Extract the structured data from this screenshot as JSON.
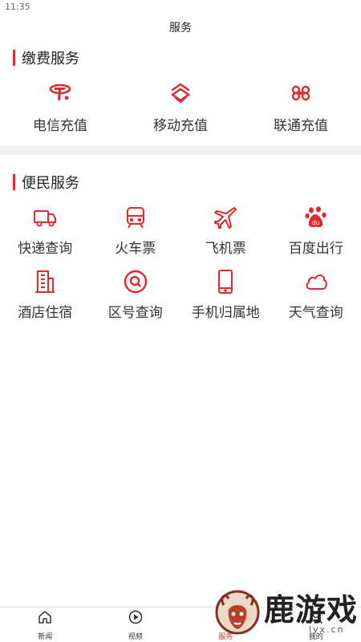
{
  "status_bar": {
    "time": "11:35"
  },
  "header": {
    "title": "服务"
  },
  "payment_section": {
    "title": "缴费服务",
    "items": [
      {
        "label": "电信充值",
        "icon": "china-telecom-icon"
      },
      {
        "label": "移动充值",
        "icon": "china-mobile-icon"
      },
      {
        "label": "联通充值",
        "icon": "china-unicom-icon"
      }
    ]
  },
  "convenience_section": {
    "title": "便民服务",
    "items": [
      {
        "label": "快递查询",
        "icon": "truck-icon"
      },
      {
        "label": "火车票",
        "icon": "train-icon"
      },
      {
        "label": "飞机票",
        "icon": "airplane-icon"
      },
      {
        "label": "百度出行",
        "icon": "baidu-paw-icon"
      },
      {
        "label": "酒店住宿",
        "icon": "building-icon"
      },
      {
        "label": "区号查询",
        "icon": "search-circle-icon"
      },
      {
        "label": "手机归属地",
        "icon": "phone-icon"
      },
      {
        "label": "天气查询",
        "icon": "cloud-icon"
      }
    ]
  },
  "tabbar": {
    "tabs": [
      {
        "label": "新闻",
        "icon": "home-icon",
        "active": false
      },
      {
        "label": "视频",
        "icon": "play-icon",
        "active": false
      },
      {
        "label": "服务",
        "icon": "service-icon",
        "active": true
      },
      {
        "label": "我的",
        "icon": "user-icon",
        "active": false
      }
    ]
  },
  "watermark": {
    "text": "鹿游戏",
    "url": "lyx.cn"
  },
  "colors": {
    "accent": "#e0292d",
    "text": "#333333",
    "divider": "#f2f2f2"
  }
}
